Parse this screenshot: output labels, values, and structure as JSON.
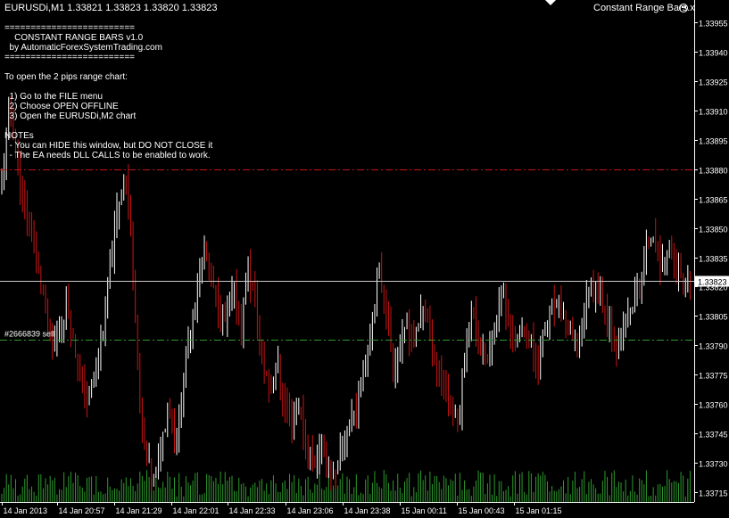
{
  "header": {
    "title": "EURUSDi,M1  1.33821 1.33823 1.33820 1.33823",
    "indicator": "Constant Range Bars.x"
  },
  "comment_lines": [
    "=========================",
    "    CONSTANT RANGE BARS v1.0",
    "  by AutomaticForexSystemTrading.com",
    "=========================",
    "",
    "To open the 2 pips range chart:",
    "",
    "  1) Go to the FILE menu",
    "  2) Choose OPEN OFFLINE",
    "  3) Open the EURUSDi,M2 chart",
    "",
    "NOTEs",
    "  - You can HIDE this window, but DO NOT CLOSE it",
    "  - The EA needs DLL CALLS to be enabled to work."
  ],
  "order_label": "#2666839 sell",
  "current_price_label": "1.33823",
  "colors": {
    "background": "#000000",
    "up_bar": "#ffffff",
    "down_bar": "#c81414",
    "volume": "#2e9a2e",
    "stop_line": "#c81414",
    "order_line": "#2e9a2e",
    "bid_line": "#c8c8c8",
    "axis": "#ffffff"
  },
  "chart_data": {
    "type": "bar",
    "symbol": "EURUSDi",
    "timeframe": "M1",
    "ylim": [
      1.3371,
      1.3396
    ],
    "yticks": [
      "1.33955",
      "1.33940",
      "1.33925",
      "1.33910",
      "1.33895",
      "1.33880",
      "1.33865",
      "1.33850",
      "1.33835",
      "1.33820",
      "1.33805",
      "1.33790",
      "1.33775",
      "1.33760",
      "1.33745",
      "1.33730",
      "1.33715"
    ],
    "xticks": [
      "14 Jan 2013",
      "14 Jan 20:57",
      "14 Jan 21:29",
      "14 Jan 22:01",
      "14 Jan 22:33",
      "14 Jan 23:06",
      "14 Jan 23:38",
      "15 Jan 00:11",
      "15 Jan 00:43",
      "15 Jan 01:15"
    ],
    "horizontal_lines": [
      {
        "name": "stop level",
        "price": 1.3388,
        "style": "dashdot"
      },
      {
        "name": "#2666839 sell",
        "price": 1.33793,
        "style": "dashdot"
      },
      {
        "name": "bid",
        "price": 1.33823,
        "style": "solid"
      }
    ],
    "close_series": [
      1.3387,
      1.3391,
      1.3389,
      1.3386,
      1.3385,
      1.3383,
      1.3381,
      1.3379,
      1.338,
      1.3381,
      1.3379,
      1.3377,
      1.3376,
      1.3378,
      1.338,
      1.3383,
      1.3386,
      1.3388,
      1.3384,
      1.3376,
      1.3373,
      1.3372,
      1.3374,
      1.3376,
      1.3374,
      1.3377,
      1.338,
      1.3382,
      1.3384,
      1.3382,
      1.3381,
      1.338,
      1.3382,
      1.338,
      1.3383,
      1.3381,
      1.3378,
      1.3377,
      1.3378,
      1.3376,
      1.3375,
      1.3376,
      1.3374,
      1.3373,
      1.3374,
      1.3373,
      1.3372,
      1.3374,
      1.3375,
      1.3376,
      1.3378,
      1.338,
      1.3383,
      1.3381,
      1.3378,
      1.3379,
      1.338,
      1.3379,
      1.3381,
      1.338,
      1.3378,
      1.3377,
      1.3376,
      1.3375,
      1.3379,
      1.3381,
      1.3379,
      1.3378,
      1.338,
      1.3382,
      1.338,
      1.3379,
      1.338,
      1.3379,
      1.3378,
      1.338,
      1.3381,
      1.3381,
      1.338,
      1.3379,
      1.338,
      1.3382,
      1.3382,
      1.3381,
      1.338,
      1.3379,
      1.338,
      1.3381,
      1.3382,
      1.3384,
      1.3385,
      1.3383,
      1.3384,
      1.3383,
      1.3382,
      1.3382
    ]
  }
}
